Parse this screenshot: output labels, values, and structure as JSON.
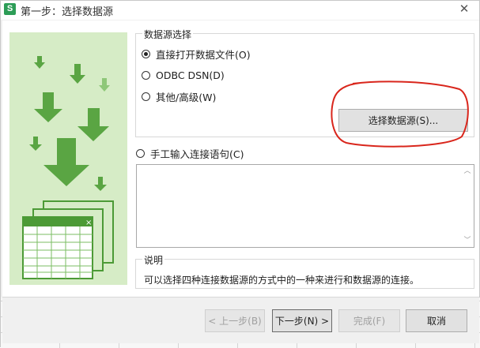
{
  "window": {
    "title": "第一步：选择数据源",
    "app_icon_letter": "S"
  },
  "datasource_group": {
    "legend": "数据源选择",
    "options": [
      {
        "label": "直接打开数据文件(O)",
        "checked": true
      },
      {
        "label": "ODBC DSN(D)",
        "checked": false
      },
      {
        "label": "其他/高级(W)",
        "checked": false
      }
    ],
    "select_button": "选择数据源(S)..."
  },
  "manual": {
    "label": "手工输入连接语句(C)",
    "checked": false,
    "value": ""
  },
  "description_group": {
    "legend": "说明",
    "text": "可以选择四种连接数据源的方式中的一种来进行和数据源的连接。"
  },
  "footer": {
    "prev": "< 上一步(B)",
    "next": "下一步(N) >",
    "finish": "完成(F)",
    "cancel": "取消"
  },
  "colors": {
    "accent_green": "#2d9d57",
    "art_bg": "#d6ecc6",
    "art_arrow": "#5aa543",
    "highlight_red": "#d9261c"
  }
}
